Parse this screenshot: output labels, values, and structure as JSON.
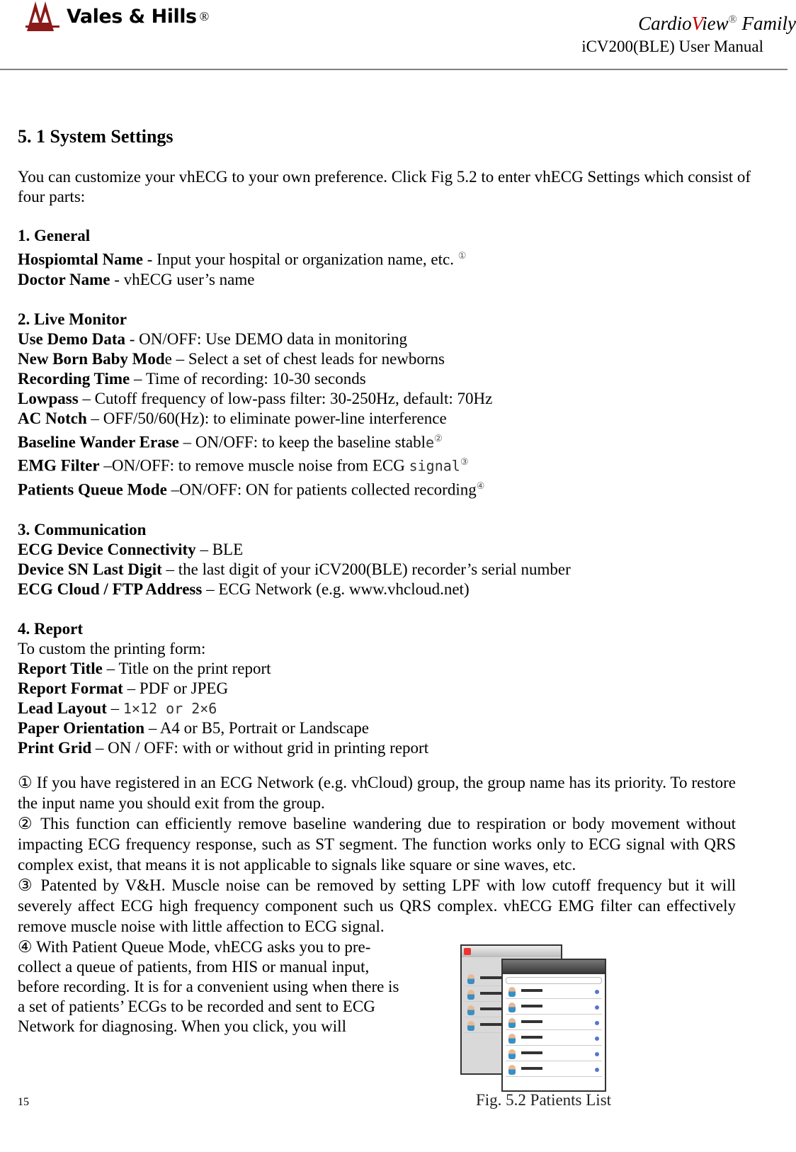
{
  "header": {
    "logo_text": "Vales & Hills",
    "logo_reg": "®",
    "brand_a": "Cardio",
    "brand_v": "V",
    "brand_b": "iew",
    "brand_reg": "®",
    "brand_c": " Family",
    "manual": "iCV200(BLE) User Manual",
    "brand_accent": "#c00000",
    "logo_color": "#8b1a1a"
  },
  "title": "5. 1 System Settings",
  "intro": "You can customize your vhECG to your own preference. Click Fig 5.2 to enter vhECG Settings which consist of four parts:",
  "sections": [
    {
      "heading": "1. General",
      "lines": [
        {
          "b": "Hospiomtal Name",
          "t": " - Input your hospital or organization name, etc. ",
          "s": "①"
        },
        {
          "b": "Doctor Name",
          "t": " - vhECG user’s name"
        }
      ]
    },
    {
      "heading": "2. Live Monitor",
      "lines": [
        {
          "b": "Use Demo Data",
          "t": " - ON/OFF: Use DEMO data in monitoring"
        },
        {
          "b": "New Born Baby Mod",
          "t": "e – Select a set of chest leads for newborns"
        },
        {
          "b": "Recording Time",
          "t": " – Time of recording: 10-30 seconds"
        },
        {
          "b": "Lowpass",
          "t": " – Cutoff frequency of low-pass filter: 30-250Hz, default: 70Hz"
        },
        {
          "b": "AC Notch",
          "t": " – OFF/50/60(Hz): to eliminate power-line interference"
        },
        {
          "b": "Baseline Wander Erase",
          "t": " – ON/OFF: to keep the baseline stabl",
          "m": "e",
          "s": "②"
        },
        {
          "b": "EMG Filter",
          "t": " –ON/OFF: to remove muscle noise from ECG ",
          "m": "signal",
          "s": "③"
        },
        {
          "b": "Patients Queue Mode",
          "t": " –ON/OFF: ON for patients collected recording",
          "s": "④"
        }
      ]
    },
    {
      "heading": "3. Communication",
      "lines": [
        {
          "b": "ECG Device Connectivity",
          "t": " – BLE"
        },
        {
          "b": "Device SN Last Digit",
          "t": " – the last digit of your iCV200(BLE) recorder’s serial number"
        },
        {
          "b": "ECG Cloud / FTP Address",
          "t": " – ECG Network (e.g. www.vhcloud.net)"
        }
      ]
    },
    {
      "heading": "4. Report",
      "lines": [
        {
          "t": "To custom the printing form:"
        },
        {
          "b": "Report Title",
          "t": " – Title on the print report"
        },
        {
          "b": "Report Format",
          "t": " – PDF or JPEG"
        },
        {
          "b": "Lead Layout",
          "t": " – ",
          "m": "1×12 or 2×6"
        },
        {
          "b": "Paper Orientation",
          "t": " – A4 or B5, Portrait or Landscape"
        },
        {
          "b": "Print Grid",
          "t": " – ON / OFF: with or without grid in printing report"
        }
      ]
    }
  ],
  "notes": [
    "① If you have registered in an ECG Network (e.g. vhCloud) group, the group name has its priority. To restore the input name you should exit from the group.",
    "②  This function can efficiently remove baseline wandering due to respiration or body movement without impacting ECG frequency response, such as ST segment. The function works only to ECG signal with QRS complex exist, that means it is not applicable to signals like square or sine waves, etc.",
    "③ Patented by V&H. Muscle noise can be removed by setting LPF with low cutoff frequency but it will severely affect ECG high frequency component such us QRS complex. vhECG EMG filter can effectively remove muscle noise with little affection to ECG signal."
  ],
  "note4": "④ With Patient Queue Mode, vhECG asks you to pre-collect a queue of patients, from HIS or manual input, before recording. It is for a convenient using when there is a set of patients’ ECGs to be recorded and sent to ECG Network for diagnosing. When you click, you will",
  "figure": {
    "caption": "Fig. 5.2 Patients List"
  },
  "page_number": "15"
}
